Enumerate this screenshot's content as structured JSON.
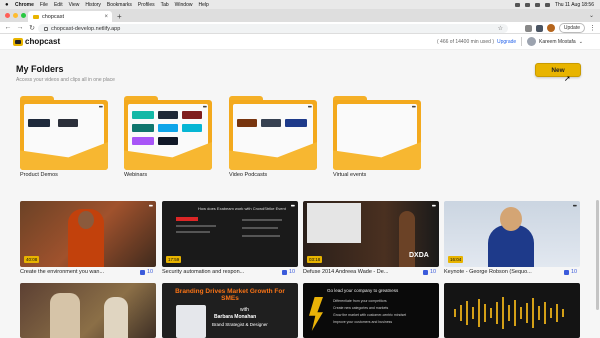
{
  "menubar": {
    "items": [
      "Chrome",
      "File",
      "Edit",
      "View",
      "History",
      "Bookmarks",
      "Profiles",
      "Tab",
      "Window",
      "Help"
    ],
    "clock": "Thu 11 Aug 18:56"
  },
  "browser": {
    "tab_title": "chopcast",
    "url": "chopcast-develop.netlify.app",
    "update_label": "Update"
  },
  "header": {
    "logo": "chopcast",
    "usage": "( 466 of 14400 min used )",
    "upgrade": "Upgrade",
    "user_name": "Kareem Mostafa"
  },
  "page": {
    "title": "My Folders",
    "subtitle": "Access your videos and clips all in one place",
    "new_label": "New"
  },
  "folders": [
    {
      "label": "Product Demos"
    },
    {
      "label": "Webinars"
    },
    {
      "label": "Video Podcasts"
    },
    {
      "label": "Virtual events"
    }
  ],
  "videos": [
    {
      "title": "Create the environment you wan...",
      "duration": "40:08",
      "count": "10"
    },
    {
      "title": "Security automation and respon...",
      "duration": "17:59",
      "count": "10"
    },
    {
      "title": "Defuse 2014 Andreea Wade - De...",
      "duration": "03:18",
      "count": "10"
    },
    {
      "title": "Keynote - George Robson (Sequo...",
      "duration": "16:04",
      "count": "10"
    }
  ],
  "slides": {
    "branding_title": "Branding Drives Market Growth For SMEs",
    "branding_with": "with",
    "branding_name": "Barbara Monahan",
    "branding_role": "Brand Strategist & Designer",
    "lead_title": "Go lead your company to greatness",
    "lead_items": [
      "Differentiate from your competitors",
      "Create new categories and markets",
      "Grow the market with customer-centric mindset",
      "Improve your customers and business"
    ],
    "security_title": "How does Exabeam work with CrowdStrike Event",
    "dxda": "DXDA"
  },
  "colors": {
    "accent": "#e8b400",
    "link": "#2563eb",
    "folder": "#f3a91d"
  }
}
